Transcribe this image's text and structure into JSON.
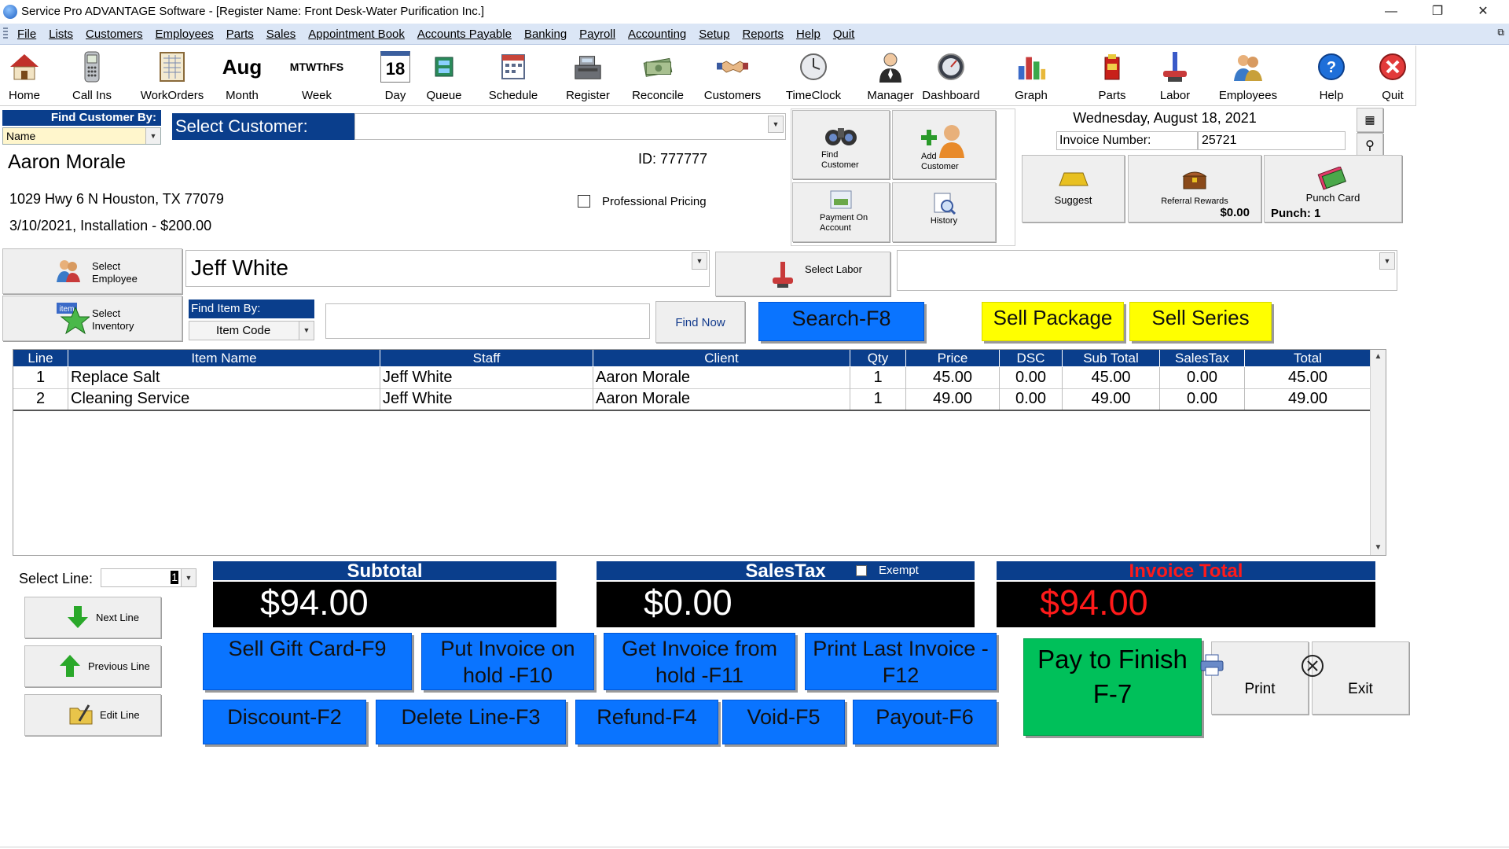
{
  "window": {
    "title": "Service Pro ADVANTAGE Software - [Register Name: Front Desk-Water Purification Inc.]",
    "minimize": "—",
    "restore": "❐",
    "close": "✕"
  },
  "menu": {
    "items": [
      "File",
      "Lists",
      "Customers",
      "Employees",
      "Parts",
      "Sales",
      "Appointment Book",
      "Accounts Payable",
      "Banking",
      "Payroll",
      "Accounting",
      "Setup",
      "Reports",
      "Help",
      "Quit"
    ],
    "restore_icon": "⧉"
  },
  "toolbar": {
    "buttons": [
      {
        "label": "Home",
        "icon": "house-icon"
      },
      {
        "label": "Call Ins",
        "icon": "phone-icon"
      },
      {
        "label": "WorkOrders",
        "icon": "workorders-icon"
      },
      {
        "label": "Month",
        "icon": "calendar-month-icon",
        "text": "Aug"
      },
      {
        "label": "Week",
        "icon": "calendar-week-icon",
        "text": "MTWThFS"
      },
      {
        "label": "Day",
        "icon": "calendar-day-icon",
        "text": "18"
      },
      {
        "label": "Queue",
        "icon": "queue-icon"
      },
      {
        "label": "Schedule",
        "icon": "schedule-icon"
      },
      {
        "label": "Register",
        "icon": "cash-register-icon"
      },
      {
        "label": "Reconcile",
        "icon": "money-icon"
      },
      {
        "label": "Customers",
        "icon": "handshake-icon"
      },
      {
        "label": "TimeClock",
        "icon": "clock-icon"
      },
      {
        "label": "Manager",
        "icon": "manager-icon"
      },
      {
        "label": "Dashboard",
        "icon": "gauge-icon"
      },
      {
        "label": "Graph",
        "icon": "bar-graph-icon"
      },
      {
        "label": "Parts",
        "icon": "parts-icon"
      },
      {
        "label": "Labor",
        "icon": "labor-icon"
      },
      {
        "label": "Employees",
        "icon": "employees-icon"
      },
      {
        "label": "Help",
        "icon": "help-icon"
      },
      {
        "label": "Quit",
        "icon": "quit-icon"
      }
    ]
  },
  "customer": {
    "find_by_label": "Find Customer By:",
    "find_by_value": "Name",
    "select_label": "Select Customer:",
    "select_value": "",
    "name": "Aaron Morale",
    "id_text": "ID: 777777",
    "address": "1029 Hwy 6 N Houston, TX 77079",
    "last_visit": "3/10/2021, Installation - $200.00",
    "professional_pricing_label": "Professional Pricing",
    "professional_pricing_checked": false
  },
  "customer_actions": {
    "find_customer": "Find Customer",
    "add_customer": "Add Customer",
    "payment_on_account": "Payment On Account",
    "history": "History"
  },
  "invoice_info": {
    "date": "Wednesday, August 18, 2021",
    "number_label": "Invoice Number:",
    "number": "25721",
    "suggest": "Suggest",
    "referral_rewards": "Referral Rewards",
    "referral_amount": "$0.00",
    "punch_card": "Punch Card",
    "punch_count": "Punch: 1"
  },
  "employee": {
    "select_employee": "Select Employee",
    "value": "Jeff White",
    "select_labor": "Select Labor",
    "labor_value": ""
  },
  "item_find": {
    "select_inventory": "Select Inventory",
    "find_by_label": "Find Item By:",
    "find_by_value": "Item Code",
    "input_value": "",
    "find_now": "Find Now",
    "search": "Search-F8",
    "sell_package": "Sell Package",
    "sell_series": "Sell Series"
  },
  "grid": {
    "columns": [
      "Line",
      "Item Name",
      "Staff",
      "Client",
      "Qty",
      "Price",
      "DSC",
      "Sub Total",
      "SalesTax",
      "Total"
    ],
    "rows": [
      [
        "1",
        "Replace Salt",
        "Jeff White",
        "Aaron Morale",
        "1",
        "45.00",
        "0.00",
        "45.00",
        "0.00",
        "45.00"
      ],
      [
        "2",
        "Cleaning Service",
        "Jeff White",
        "Aaron Morale",
        "1",
        "49.00",
        "0.00",
        "49.00",
        "0.00",
        "49.00"
      ]
    ]
  },
  "line_controls": {
    "select_line_label": "Select Line:",
    "select_line_value": "1",
    "next_line": "Next Line",
    "previous_line": "Previous Line",
    "edit_line": "Edit Line"
  },
  "totals": {
    "subtotal_label": "Subtotal",
    "subtotal": "$94.00",
    "salestax_label": "SalesTax",
    "salestax": "$0.00",
    "exempt_label": "Exempt",
    "exempt_checked": false,
    "invoice_total_label": "Invoice Total",
    "invoice_total": "$94.00",
    "invoice_total_color": "#ff1a1a"
  },
  "actions": {
    "sell_gift_card": "Sell Gift Card-F9",
    "put_on_hold": "Put Invoice on hold -F10",
    "get_from_hold": "Get Invoice from hold -F11",
    "print_last": "Print Last Invoice - F12",
    "discount": "Discount-F2",
    "delete_line": "Delete Line-F3",
    "refund": "Refund-F4",
    "void": "Void-F5",
    "payout": "Payout-F6",
    "pay_to_finish": "Pay to Finish F-7",
    "print": "Print",
    "exit": "Exit"
  },
  "colors": {
    "header_blue": "#0a3e8c",
    "action_blue": "#0a74ff",
    "package_yellow": "#ffff00",
    "pay_green": "#00c05a",
    "total_red": "#ff1a1a"
  }
}
